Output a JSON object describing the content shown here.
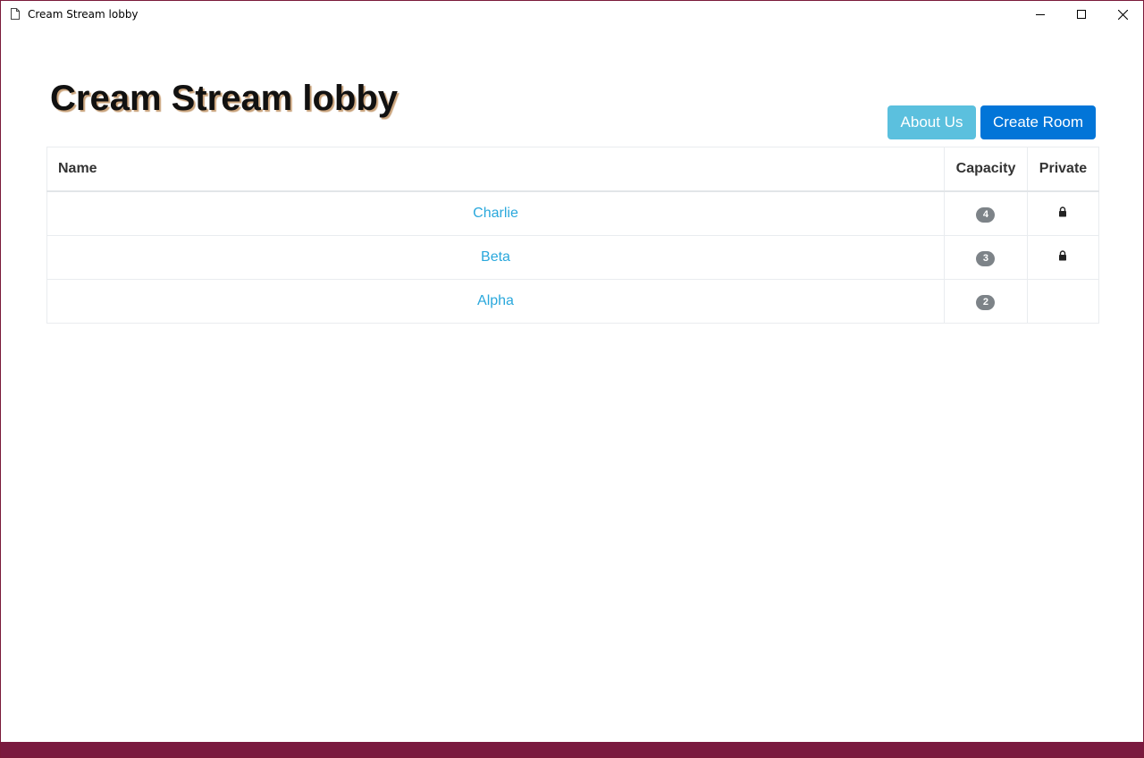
{
  "window": {
    "title": "Cream Stream lobby",
    "controls": [
      "minimize-icon",
      "maximize-icon",
      "close-icon"
    ]
  },
  "header": {
    "title": "Cream Stream lobby",
    "about_label": "About Us",
    "create_label": "Create Room"
  },
  "table": {
    "headers": {
      "name": "Name",
      "capacity": "Capacity",
      "private": "Private"
    },
    "rows": [
      {
        "name": "Charlie",
        "capacity": "4",
        "private": true,
        "private_icon": "lock-icon"
      },
      {
        "name": "Beta",
        "capacity": "3",
        "private": true,
        "private_icon": "lock-icon"
      },
      {
        "name": "Alpha",
        "capacity": "2",
        "private": false,
        "private_icon": ""
      }
    ]
  },
  "colors": {
    "window_border": "#7a1a3a",
    "bottom_bar": "#7a1a3f",
    "about_button": "#5bc0de",
    "create_button": "#0275d8",
    "link": "#2aa8dc",
    "badge": "#7d8388"
  }
}
